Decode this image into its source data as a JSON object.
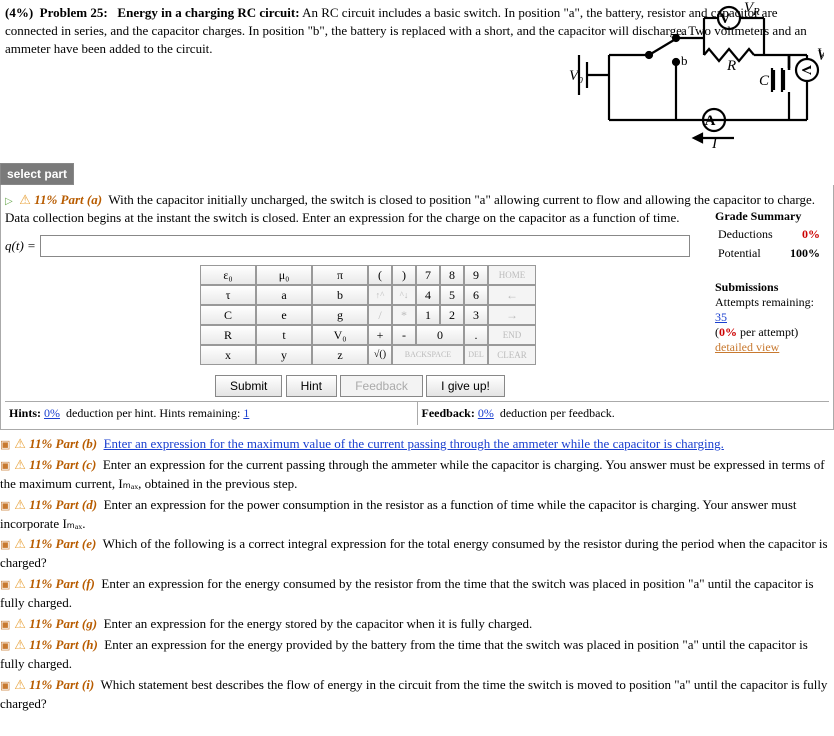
{
  "problem": {
    "weight_label": "(4%)",
    "number_label": "Problem 25:",
    "title": "Energy in a charging RC circuit:",
    "text": "An RC circuit includes a basic switch. In position \"a\", the battery, resistor and capacitor are connected in series, and the capacitor charges. In position \"b\", the battery is replaced with a short, and the capacitor will discharge. Two voltmeters and an ammeter have been added to the circuit."
  },
  "select_part_label": "select part",
  "active_part": {
    "percent": "11%",
    "label": "Part (a)",
    "prompt": "With the capacitor initially uncharged, the switch is closed to position \"a\" allowing current to flow and allowing the capacitor to charge. Data collection begins at the instant the switch is closed. Enter an expression for the charge on the capacitor as a function of time.",
    "lhs": "q(t) = ",
    "input_value": ""
  },
  "grade": {
    "title": "Grade Summary",
    "deductions_label": "Deductions",
    "deductions_value": "0%",
    "potential_label": "Potential",
    "potential_value": "100%",
    "submissions_label": "Submissions",
    "attempts_label": "Attempts remaining:",
    "attempts_value": "35",
    "per_attempt": "(0% per attempt)",
    "detailed_view": "detailed view"
  },
  "keypad": {
    "r1": [
      "ε₀",
      "μ₀",
      "π",
      "(",
      ")",
      "7",
      "8",
      "9",
      "HOME"
    ],
    "r2": [
      "τ",
      "a",
      "b",
      "↑^",
      "^↓",
      "4",
      "5",
      "6",
      "←"
    ],
    "r3": [
      "C",
      "e",
      "g",
      "/",
      "*",
      "1",
      "2",
      "3",
      "→"
    ],
    "r4": [
      "R",
      "t",
      "V₀",
      "+",
      "-",
      "0",
      ".",
      "END"
    ],
    "r5": [
      "x",
      "y",
      "z",
      "√()",
      "BACKSPACE",
      "DEL",
      "CLEAR"
    ]
  },
  "buttons": {
    "submit": "Submit",
    "hint": "Hint",
    "feedback": "Feedback",
    "giveup": "I give up!"
  },
  "hints_row": {
    "hints_label": "Hints:",
    "hints_pct": "0%",
    "hints_text": "deduction per hint. Hints remaining:",
    "hints_remaining": "1",
    "feedback_label": "Feedback:",
    "feedback_pct": "0%",
    "feedback_text": "deduction per feedback."
  },
  "other_parts": [
    {
      "id": "b",
      "percent": "11%",
      "label": "Part (b)",
      "text": "Enter an expression for the maximum value of the current passing through the ammeter while the capacitor is charging.",
      "underline": true
    },
    {
      "id": "c",
      "percent": "11%",
      "label": "Part (c)",
      "text": "Enter an expression for the current passing through the ammeter while the capacitor is charging. You answer must be expressed in terms of the maximum current, Iₘₐₓ, obtained in the previous step."
    },
    {
      "id": "d",
      "percent": "11%",
      "label": "Part (d)",
      "text": "Enter an expression for the power consumption in the resistor as a function of time while the capacitor is charging. Your answer must incorporate Iₘₐₓ."
    },
    {
      "id": "e",
      "percent": "11%",
      "label": "Part (e)",
      "text": "Which of the following is a correct integral expression for the total energy consumed by the resistor during the period when the capacitor is charged?"
    },
    {
      "id": "f",
      "percent": "11%",
      "label": "Part (f)",
      "text": "Enter an expression for the energy consumed by the resistor from the time that the switch was placed in position \"a\" until the capacitor is fully charged."
    },
    {
      "id": "g",
      "percent": "11%",
      "label": "Part (g)",
      "text": "Enter an expression for the energy stored by the capacitor when it is fully charged."
    },
    {
      "id": "h",
      "percent": "11%",
      "label": "Part (h)",
      "text": "Enter an expression for the energy provided by the battery from the time that the switch was placed in position \"a\" until the capacitor is fully charged."
    },
    {
      "id": "i",
      "percent": "11%",
      "label": "Part (i)",
      "text": "Which statement best describes the flow of energy in the circuit from the time the switch is moved to position \"a\" until the capacitor is fully charged?"
    }
  ]
}
